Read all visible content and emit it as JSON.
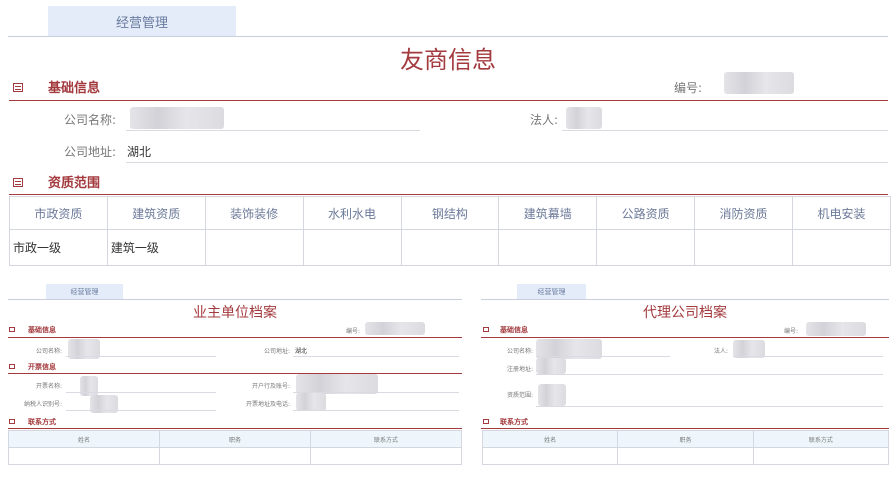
{
  "tab_label": "经营管理",
  "title": "友商信息",
  "basic": {
    "section": "基础信息",
    "number_label": "编号:",
    "company_name_label": "公司名称:",
    "legal_label": "法人:",
    "address_label": "公司地址:",
    "address_value": "湖北"
  },
  "qual": {
    "section": "资质范围",
    "headers": [
      "市政资质",
      "建筑资质",
      "装饰装修",
      "水利水电",
      "钢结构",
      "建筑幕墙",
      "公路资质",
      "消防资质",
      "机电安装"
    ],
    "values": [
      "市政一级",
      "建筑一级",
      "",
      "",
      "",
      "",
      "",
      "",
      ""
    ]
  },
  "owner": {
    "tab_label": "经营管理",
    "title": "业主单位档案",
    "basic_section": "基础信息",
    "number_label": "编号:",
    "company_name_label": "公司名称:",
    "address_label": "公司地址:",
    "address_value": "湖北",
    "invoice_section": "开票信息",
    "invoice_name_label": "开票名称:",
    "bank_label": "开户行及账号:",
    "taxpayer_label": "纳税人识别号:",
    "invoice_addr_label": "开票地址及电话:",
    "contact_section": "联系方式",
    "contact_headers": [
      "姓名",
      "职务",
      "联系方式"
    ]
  },
  "agent": {
    "tab_label": "经营管理",
    "title": "代理公司档案",
    "basic_section": "基础信息",
    "number_label": "编号:",
    "company_name_label": "公司名称:",
    "legal_label": "法人:",
    "reg_addr_label": "注册地址:",
    "qual_label": "资质范围:",
    "contact_section": "联系方式",
    "contact_headers": [
      "姓名",
      "职务",
      "联系方式"
    ]
  }
}
